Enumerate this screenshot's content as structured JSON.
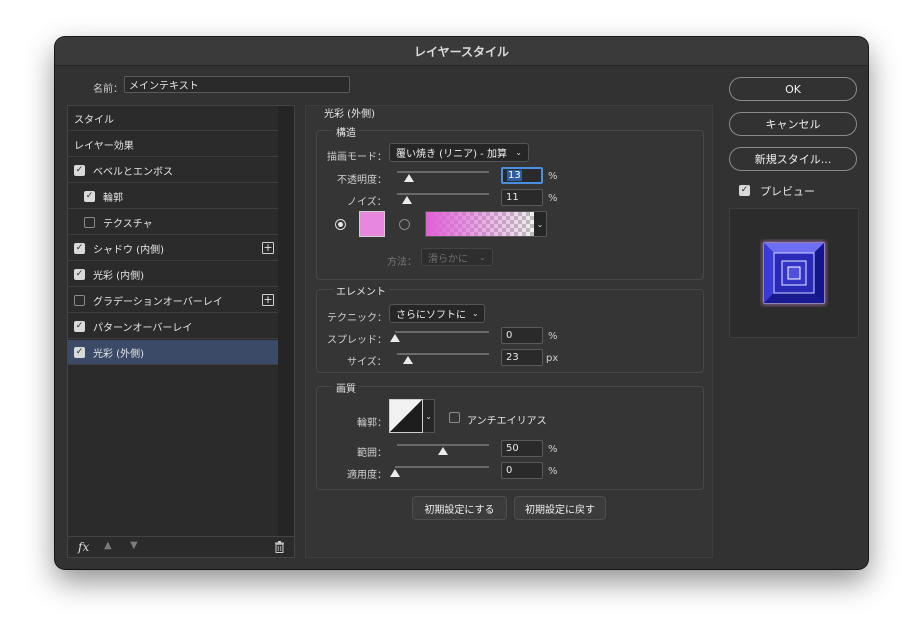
{
  "window": {
    "title": "レイヤースタイル"
  },
  "name_field": {
    "label": "名前：",
    "value": "メインテキスト"
  },
  "sidebar": {
    "items": [
      {
        "label": "スタイル",
        "checkbox": "none",
        "indent": false,
        "plus": false,
        "selected": false
      },
      {
        "label": "レイヤー効果",
        "checkbox": "none",
        "indent": false,
        "plus": false,
        "selected": false
      },
      {
        "label": "ベベルとエンボス",
        "checkbox": "on",
        "indent": false,
        "plus": false,
        "selected": false
      },
      {
        "label": "輪郭",
        "checkbox": "on",
        "indent": true,
        "plus": false,
        "selected": false
      },
      {
        "label": "テクスチャ",
        "checkbox": "off",
        "indent": true,
        "plus": false,
        "selected": false
      },
      {
        "label": "シャドウ (内側)",
        "checkbox": "on",
        "indent": false,
        "plus": true,
        "selected": false
      },
      {
        "label": "光彩 (内側)",
        "checkbox": "on",
        "indent": false,
        "plus": false,
        "selected": false
      },
      {
        "label": "グラデーションオーバーレイ",
        "checkbox": "off",
        "indent": false,
        "plus": true,
        "selected": false
      },
      {
        "label": "パターンオーバーレイ",
        "checkbox": "on",
        "indent": false,
        "plus": false,
        "selected": false
      },
      {
        "label": "光彩 (外側)",
        "checkbox": "on",
        "indent": false,
        "plus": false,
        "selected": true
      }
    ],
    "footer": {
      "fx": "fx",
      "up_icon": "arrow-up-icon",
      "down_icon": "arrow-down-icon",
      "trash_icon": "trash-icon"
    }
  },
  "panel": {
    "title": "光彩 (外側)",
    "structure": {
      "title": "構造",
      "blend_mode": {
        "label": "描画モード：",
        "value": "覆い焼き (リニア) - 加算"
      },
      "opacity": {
        "label": "不透明度：",
        "value": "13",
        "unit": "%",
        "level": 0.13
      },
      "noise": {
        "label": "ノイズ：",
        "value": "11",
        "unit": "%",
        "level": 0.11
      },
      "color_swatch": "#e887e0",
      "gradient_from": "#e060d8",
      "method": {
        "label": "方法：",
        "value": "滑らかに"
      }
    },
    "elements": {
      "title": "エレメント",
      "technique": {
        "label": "テクニック：",
        "value": "さらにソフトに"
      },
      "spread": {
        "label": "スプレッド：",
        "value": "0",
        "unit": "%",
        "level": 0.0
      },
      "size": {
        "label": "サイズ：",
        "value": "23",
        "unit": "px",
        "level": 0.12
      }
    },
    "quality": {
      "title": "画質",
      "contour": {
        "label": "輪郭："
      },
      "antialias": {
        "label": "アンチエイリアス",
        "checked": false
      },
      "range": {
        "label": "範囲：",
        "value": "50",
        "unit": "%",
        "level": 0.5
      },
      "jitter": {
        "label": "適用度：",
        "value": "0",
        "unit": "%",
        "level": 0.0
      }
    },
    "make_default": "初期設定にする",
    "reset_default": "初期設定に戻す"
  },
  "buttons": {
    "ok": "OK",
    "cancel": "キャンセル",
    "new_style": "新規スタイル...",
    "preview_label": "プレビュー",
    "preview_checked": true
  },
  "colors": {
    "accent": "#3b4a66",
    "glow": "#e887e0",
    "focus": "#4a90e2"
  }
}
